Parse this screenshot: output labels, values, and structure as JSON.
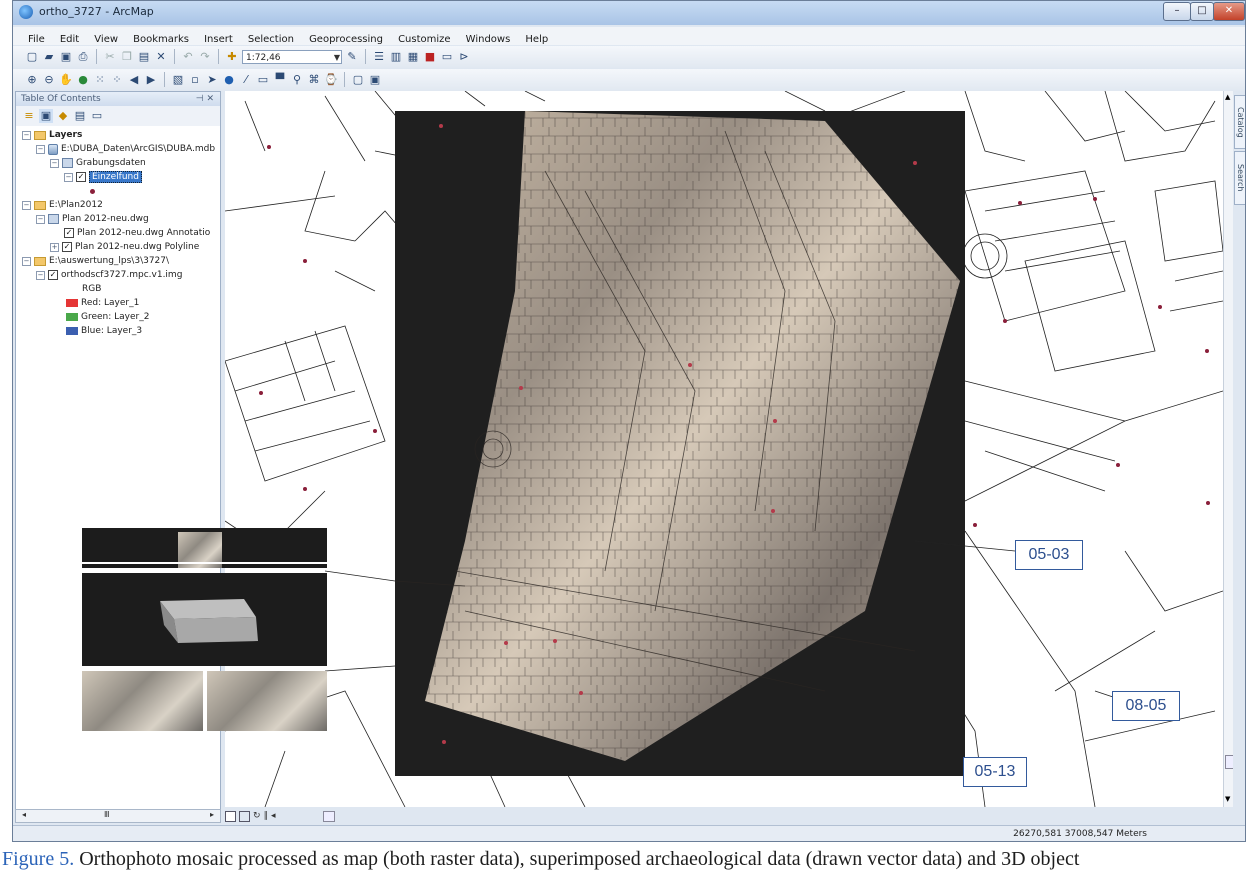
{
  "window": {
    "title": "ortho_3727 - ArcMap",
    "controls": {
      "minimize": "–",
      "maximize": "□",
      "close": "✕"
    }
  },
  "menu": [
    "File",
    "Edit",
    "View",
    "Bookmarks",
    "Insert",
    "Selection",
    "Geoprocessing",
    "Customize",
    "Windows",
    "Help"
  ],
  "toolbar": {
    "scale": "1:72,46",
    "standard_icons": [
      "new-icon",
      "open-icon",
      "save-icon",
      "print-icon",
      "cut-icon",
      "copy-icon",
      "paste-icon",
      "delete-icon",
      "undo-icon",
      "redo-icon",
      "add-data-icon"
    ],
    "tools_icons": [
      "zoom-in-icon",
      "zoom-out-icon",
      "pan-icon",
      "full-extent-icon",
      "fixed-zoom-in-icon",
      "fixed-zoom-out-icon",
      "back-icon",
      "forward-icon",
      "select-features-icon",
      "select-elements-icon",
      "identify-icon",
      "hyperlink-icon",
      "html-popup-icon",
      "measure-icon",
      "find-icon",
      "route-icon",
      "time-slider-icon",
      "viewer-icon"
    ]
  },
  "toc": {
    "title": "Table Of Contents",
    "pin": "⊣ ✕",
    "tree": [
      {
        "label": "Layers",
        "level": 0,
        "type": "layers",
        "expander": "−"
      },
      {
        "label": "E:\\DUBA_Daten\\ArcGIS\\DUBA.mdb",
        "level": 1,
        "type": "db",
        "expander": "−"
      },
      {
        "label": "Grabungsdaten",
        "level": 2,
        "type": "group",
        "expander": "−"
      },
      {
        "label": "Einzelfund",
        "level": 3,
        "type": "layer",
        "checked": true,
        "selected": true,
        "expander": "−"
      },
      {
        "label": "E:\\Plan2012",
        "level": 0,
        "type": "folder",
        "expander": "−"
      },
      {
        "label": "Plan 2012-neu.dwg",
        "level": 1,
        "type": "group",
        "expander": "−"
      },
      {
        "label": "Plan 2012-neu.dwg Annotatio",
        "level": 2,
        "type": "layer",
        "checked": true
      },
      {
        "label": "Plan 2012-neu.dwg Polyline",
        "level": 2,
        "type": "layer",
        "checked": true,
        "expander": "+"
      },
      {
        "label": "E:\\auswertung_lps\\3\\3727\\",
        "level": 0,
        "type": "folder",
        "expander": "−"
      },
      {
        "label": "orthodscf3727.mpc.v1.img",
        "level": 1,
        "type": "layer",
        "checked": true,
        "expander": "−"
      },
      {
        "label": "RGB",
        "level": 2,
        "type": "text"
      },
      {
        "label": "Red: Layer_1",
        "level": 2,
        "type": "swatch",
        "color": "#e53535"
      },
      {
        "label": "Green: Layer_2",
        "level": 2,
        "type": "swatch",
        "color": "#4aa84a"
      },
      {
        "label": "Blue: Layer_3",
        "level": 2,
        "type": "swatch",
        "color": "#3b5fb0"
      }
    ]
  },
  "sidebar_tabs": [
    "Catalog",
    "Search"
  ],
  "map_labels": [
    "05-03",
    "08-05",
    "05-13"
  ],
  "status": {
    "coordinates": "26270,581  37008,547 Meters"
  },
  "scrollbar": {
    "thumb": "Ⅲ"
  },
  "caption": {
    "figure": "Figure 5.",
    "text": "Orthophoto mosaic processed as map (both raster data), superimposed archaeological data (drawn vector data) and 3D object"
  },
  "colors": {
    "title_gradient_top": "#c7dbf3",
    "map_background": "#ffffff",
    "label_border": "#335a9c"
  }
}
